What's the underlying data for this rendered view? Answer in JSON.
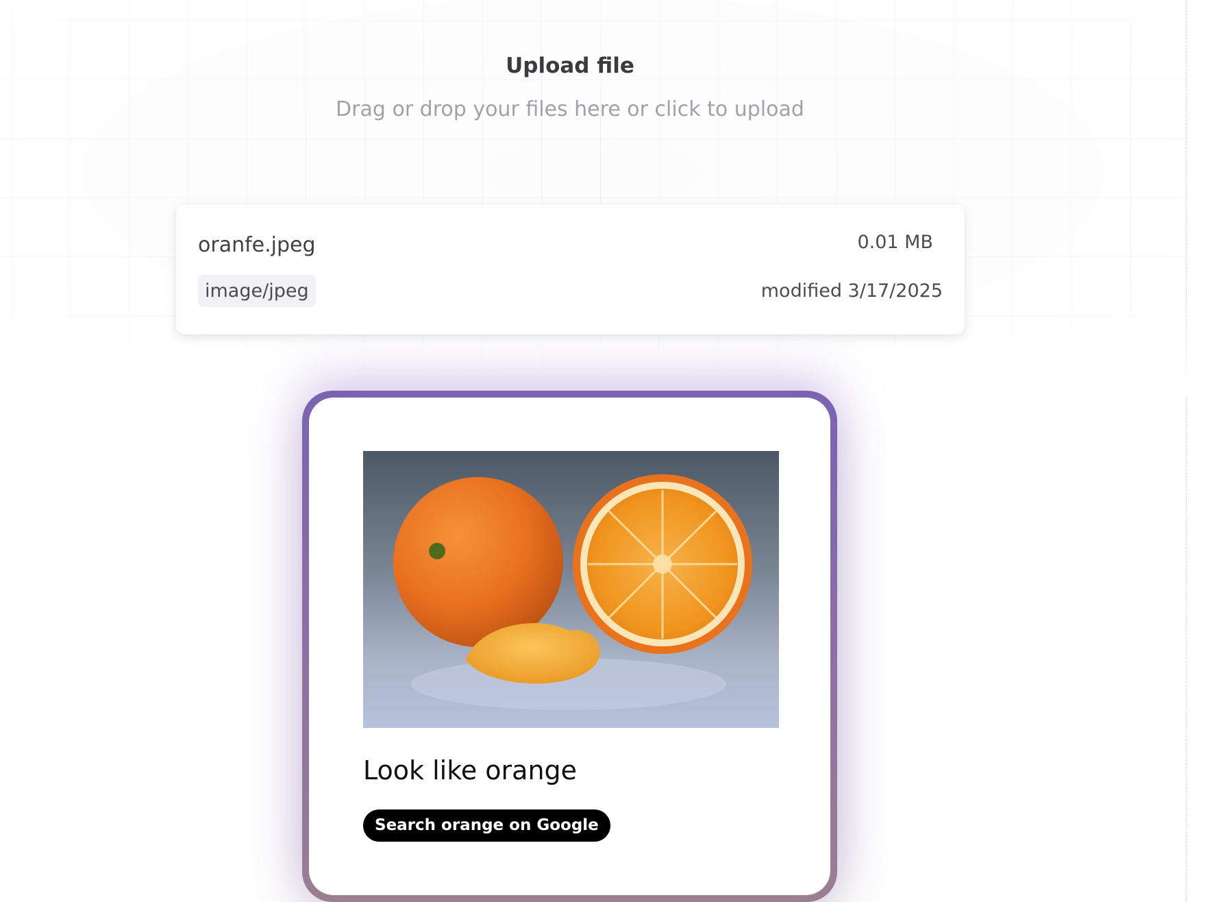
{
  "upload": {
    "title": "Upload file",
    "subtitle": "Drag or drop your files here or click to upload"
  },
  "file": {
    "name": "oranfe.jpeg",
    "size": "0.01 MB",
    "type": "image/jpeg",
    "modified": "modified 3/17/2025"
  },
  "result": {
    "image_subject": "oranges",
    "title": "Look like orange",
    "search_label": "Search orange on Google"
  },
  "colors": {
    "card_border_top": "#7a63b3",
    "card_border_bottom": "#9a7f92",
    "button_background": "#000000",
    "button_text": "#ffffff"
  }
}
